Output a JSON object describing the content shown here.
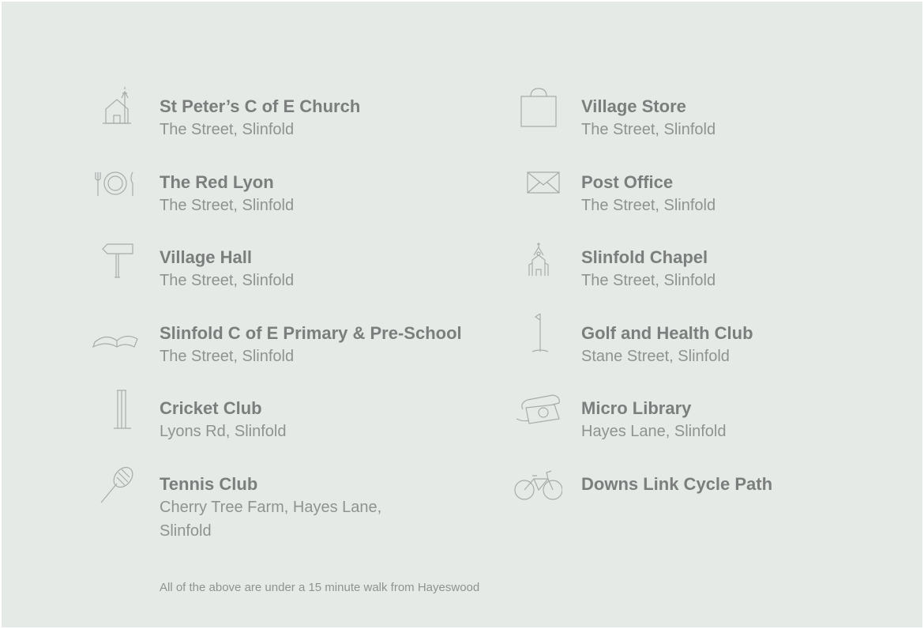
{
  "places": [
    {
      "title": "St Peter’s C of E Church",
      "address": "The Street, Slinfold",
      "icon": "church-icon"
    },
    {
      "title": "Village Store",
      "address": "The Street, Slinfold",
      "icon": "shopping-bag-icon"
    },
    {
      "title": "The Red Lyon",
      "address": "The Street, Slinfold",
      "icon": "plate-cutlery-icon"
    },
    {
      "title": "Post Office",
      "address": "The Street, Slinfold",
      "icon": "envelope-icon"
    },
    {
      "title": "Village Hall",
      "address": "The Street, Slinfold",
      "icon": "signpost-icon"
    },
    {
      "title": "Slinfold Chapel",
      "address": "The Street, Slinfold",
      "icon": "chapel-icon"
    },
    {
      "title": "Slinfold C of E Primary & Pre-School",
      "address": "The Street, Slinfold",
      "icon": "open-book-icon"
    },
    {
      "title": "Golf and Health Club",
      "address": "Stane Street, Slinfold",
      "icon": "golf-flag-icon"
    },
    {
      "title": "Cricket Club",
      "address": "Lyons Rd, Slinfold",
      "icon": "cricket-stumps-icon"
    },
    {
      "title": "Micro Library",
      "address": "Hayes Lane, Slinfold",
      "icon": "telephone-icon"
    },
    {
      "title": "Tennis Club",
      "address": "Cherry Tree Farm, Hayes Lane, Slinfold",
      "icon": "tennis-racket-icon"
    },
    {
      "title": "Downs Link Cycle Path",
      "address": "",
      "icon": "bicycle-icon"
    }
  ],
  "footer": "All of the above are under a 15 minute walk from Hayeswood",
  "colors": {
    "background": "#e5eae7",
    "title": "#7b7e7c",
    "text": "#8f9390",
    "icon": "#a7aca9"
  }
}
